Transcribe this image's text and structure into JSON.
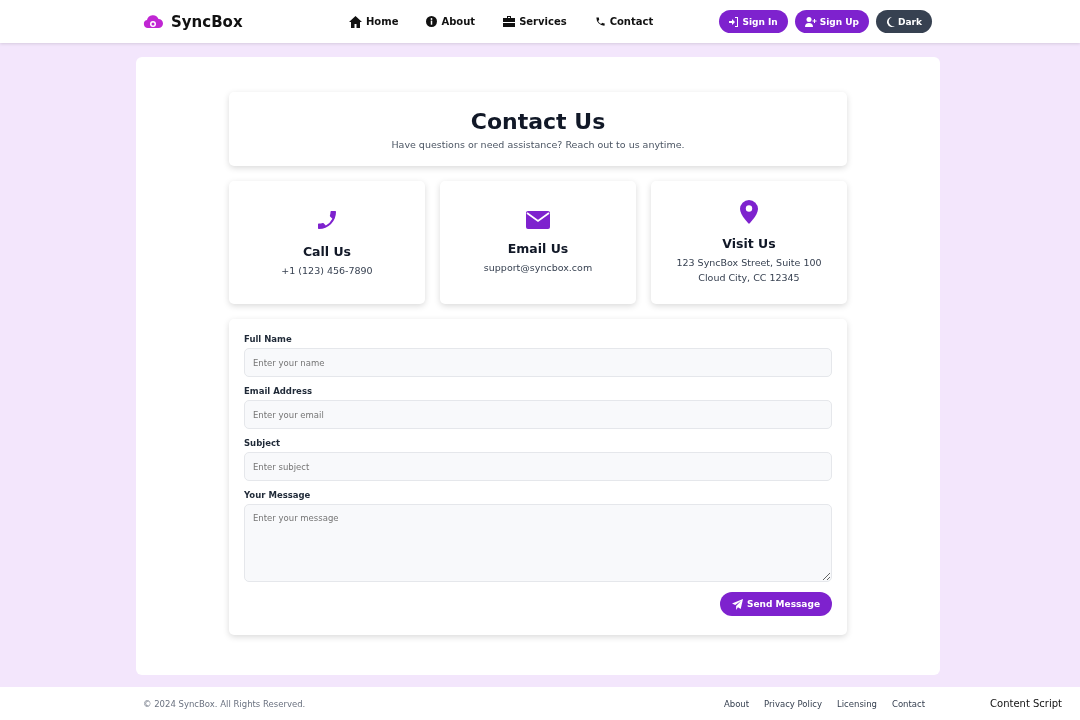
{
  "brand": {
    "name": "SyncBox"
  },
  "nav": [
    {
      "label": "Home",
      "kind": "home"
    },
    {
      "label": "About",
      "kind": "info"
    },
    {
      "label": "Services",
      "kind": "briefcase"
    },
    {
      "label": "Contact",
      "kind": "phone"
    }
  ],
  "actions": [
    {
      "label": "Sign In",
      "kind": "signin"
    },
    {
      "label": "Sign Up",
      "kind": "signup"
    },
    {
      "label": "Dark",
      "kind": "moon"
    }
  ],
  "header": {
    "title": "Contact Us",
    "subtitle": "Have questions or need assistance? Reach out to us anytime."
  },
  "cards": [
    {
      "kind": "phone",
      "title": "Call Us",
      "lines": [
        "+1 (123) 456-7890"
      ]
    },
    {
      "kind": "mail",
      "title": "Email Us",
      "lines": [
        "support@syncbox.com"
      ]
    },
    {
      "kind": "pin",
      "title": "Visit Us",
      "lines": [
        "123 SyncBox Street, Suite 100",
        "Cloud City, CC 12345"
      ]
    }
  ],
  "form": {
    "fields": [
      {
        "label": "Full Name",
        "placeholder": "Enter your name",
        "kind": "input"
      },
      {
        "label": "Email Address",
        "placeholder": "Enter your email",
        "kind": "input"
      },
      {
        "label": "Subject",
        "placeholder": "Enter subject",
        "kind": "input"
      },
      {
        "label": "Your Message",
        "placeholder": "Enter your message",
        "kind": "textarea"
      }
    ],
    "submit": "Send Message"
  },
  "footer": {
    "copyright": "© 2024 SyncBox. All Rights Reserved.",
    "links": [
      "About",
      "Privacy Policy",
      "Licensing",
      "Contact"
    ],
    "extra": "Content Script"
  }
}
